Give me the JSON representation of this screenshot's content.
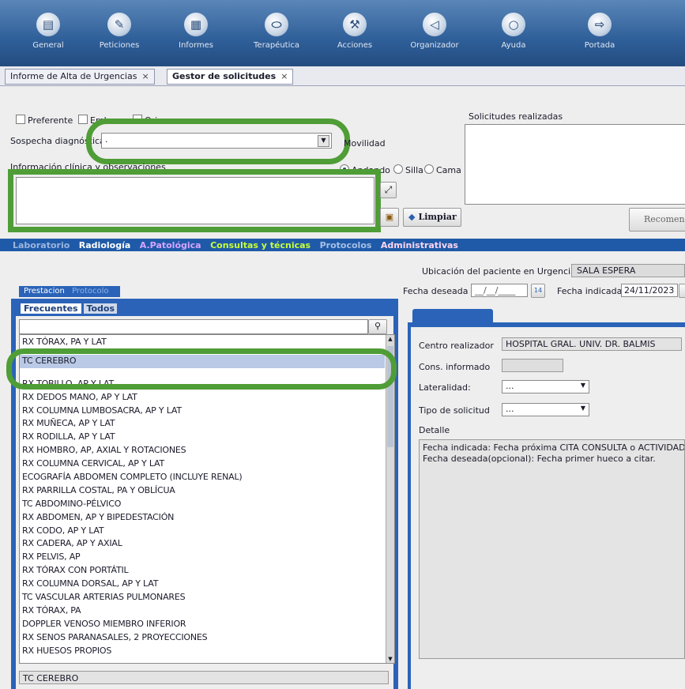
{
  "toolbar": {
    "items": [
      {
        "label": "General",
        "icon": "general-icon"
      },
      {
        "label": "Peticiones",
        "icon": "pencil-icon"
      },
      {
        "label": "Informes",
        "icon": "document-icon"
      },
      {
        "label": "Terapéutica",
        "icon": "pill-icon"
      },
      {
        "label": "Acciones",
        "icon": "actions-icon"
      },
      {
        "label": "Organizador",
        "icon": "organizer-icon"
      },
      {
        "label": "Ayuda",
        "icon": "help-bubble-icon"
      },
      {
        "label": "Portada",
        "icon": "exit-icon"
      }
    ]
  },
  "doc_tabs": [
    {
      "label": "Informe de Alta de Urgencias",
      "close": "×"
    },
    {
      "label": "Gestor de solicitudes",
      "close": "×"
    }
  ],
  "form": {
    "check_preferente": "Preferente",
    "check_embarazo": "Embarazo",
    "check_orina": "Orina",
    "sospecha_label": "Sospecha diagnóstica",
    "sospecha_value": ".",
    "movilidad_label": "Movilidad",
    "info_clinica_label": "Información clínica y observaciones",
    "mov_andando": "Andando",
    "mov_silla": "Silla",
    "mov_cama": "Cama",
    "solicitudes_label": "Solicitudes realizadas",
    "limpiar_label": "Limpiar",
    "recomendar_label": "Recomen"
  },
  "section_tabs": [
    "Laboratorio",
    "Radiología",
    "A.Patológica",
    "Consultas y técnicas",
    "Protocolos",
    "Administrativas"
  ],
  "sub_tabs": [
    "Prestacion",
    "Protocolo"
  ],
  "sub_sub_tabs": [
    "Frecuentes",
    "Todos"
  ],
  "search": {
    "value": "",
    "icon": "search-icon"
  },
  "list_items": [
    "RX TÓRAX, PA Y LAT",
    "TC CEREBRO",
    "RX TOBILLO, AP Y LAT",
    "RX DEDOS MANO, AP Y LAT",
    "RX COLUMNA LUMBOSACRA, AP Y LAT",
    "RX MUÑECA, AP Y LAT",
    "RX RODILLA, AP Y LAT",
    "RX HOMBRO, AP, AXIAL Y ROTACIONES",
    "RX COLUMNA CERVICAL, AP Y LAT",
    "ECOGRAFÍA ABDOMEN COMPLETO (INCLUYE RENAL)",
    "RX PARRILLA COSTAL, PA Y OBLÍCUA",
    "TC ABDOMINO-PÉLVICO",
    "RX ABDOMEN, AP Y BIPEDESTACIÓN",
    "RX CODO, AP Y LAT",
    "RX CADERA, AP Y AXIAL",
    "RX PELVIS, AP",
    "RX TÓRAX CON PORTÁTIL",
    "RX COLUMNA DORSAL, AP Y LAT",
    "TC VASCULAR ARTERIAS PULMONARES",
    "RX TÓRAX, PA",
    "DOPPLER VENOSO MIEMBRO INFERIOR",
    "RX SENOS PARANASALES, 2 PROYECCIONES",
    "RX HUESOS PROPIOS"
  ],
  "selected_value": "TC CEREBRO",
  "right": {
    "ubicacion_label": "Ubicación del paciente en Urgencias",
    "ubicacion_value": "SALA ESPERA",
    "fecha_deseada_label": "Fecha deseada",
    "fecha_deseada_value": "__/__/____",
    "fecha_indicada_label": "Fecha indicada",
    "fecha_indicada_value": "24/11/2023",
    "calendar_glyph": "14",
    "centro_label": "Centro realizador",
    "centro_value": "HOSPITAL GRAL. UNIV. DR. BALMIS",
    "cons_label": "Cons. informado",
    "lateralidad_label": "Lateralidad:",
    "lateralidad_value": "...",
    "tipo_label": "Tipo de solicitud",
    "tipo_value": "...",
    "detalle_label": "Detalle",
    "detalle_line1": "Fecha indicada: Fecha próxima CITA CONSULTA o ACTIVIDAD.",
    "detalle_line2": "Fecha deseada(opcional): Fecha primer hueco a citar."
  },
  "colors": {
    "toolbar": "#2f5f99",
    "highlight": "#4f9d36",
    "tab_blue": "#2a63b8"
  }
}
